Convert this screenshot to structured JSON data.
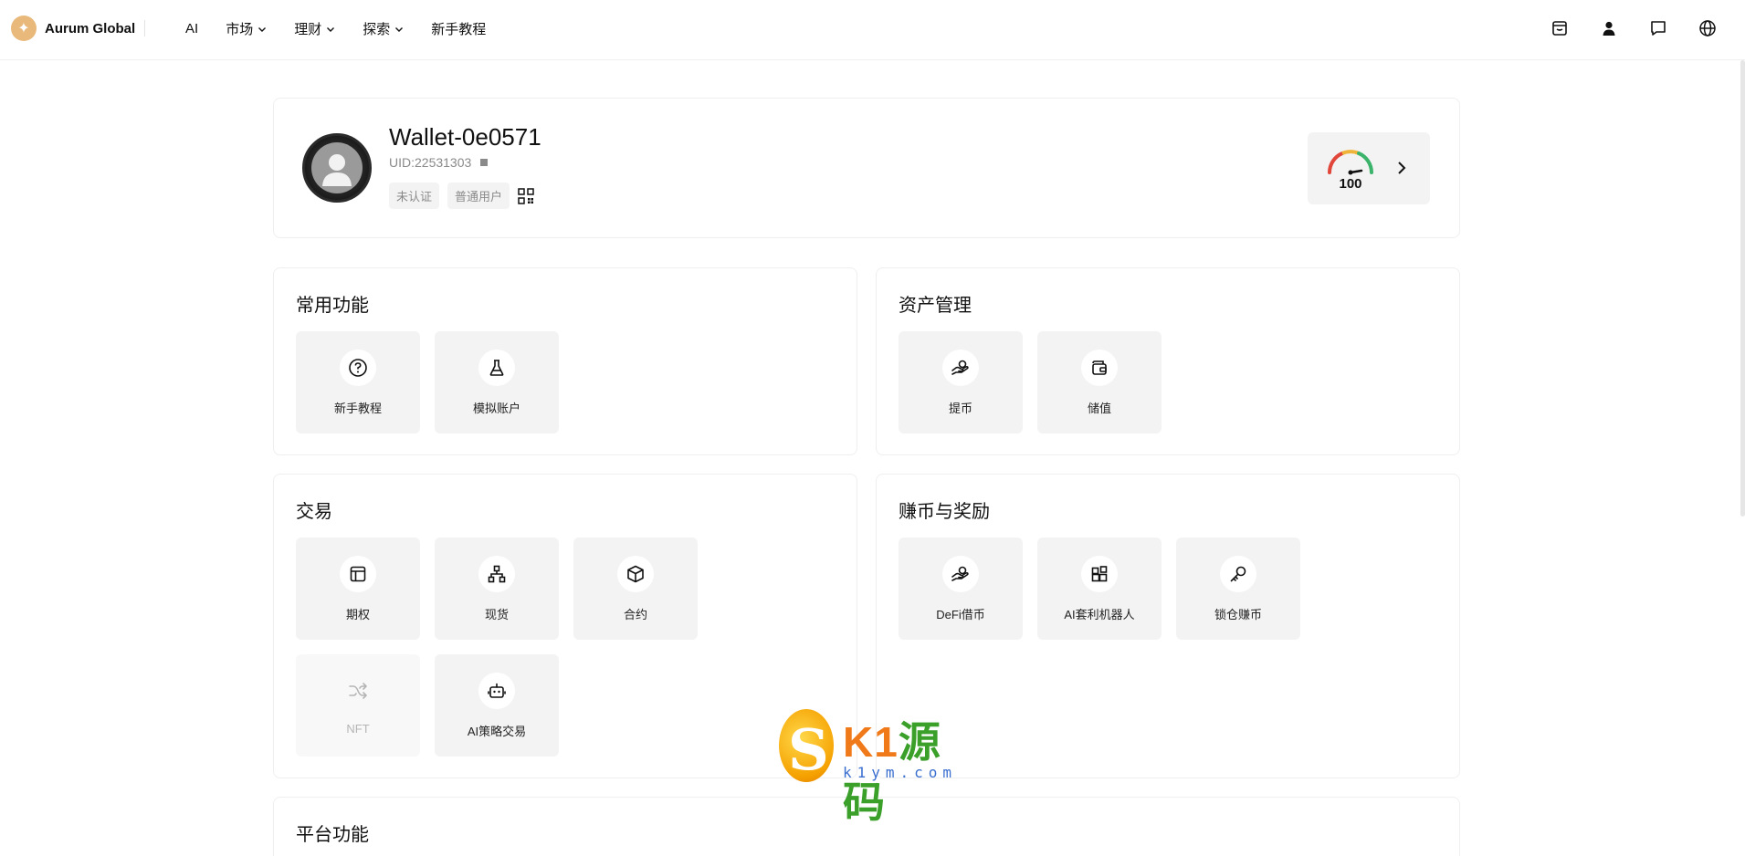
{
  "header": {
    "brand_name": "Aurum Global",
    "nav": [
      {
        "label": "AI",
        "has_dropdown": false
      },
      {
        "label": "市场",
        "has_dropdown": true
      },
      {
        "label": "理财",
        "has_dropdown": true
      },
      {
        "label": "探索",
        "has_dropdown": true
      },
      {
        "label": "新手教程",
        "has_dropdown": false
      }
    ],
    "icons": [
      "inbox-icon",
      "user-icon",
      "message-icon",
      "globe-icon"
    ]
  },
  "profile": {
    "wallet_name": "Wallet-0e0571",
    "uid": "UID:22531303",
    "tags": [
      "未认证",
      "普通用户"
    ],
    "score": "100"
  },
  "sections": {
    "common": {
      "title": "常用功能",
      "items": [
        {
          "label": "新手教程",
          "icon": "help-circle-icon"
        },
        {
          "label": "模拟账户",
          "icon": "flask-icon"
        }
      ]
    },
    "asset": {
      "title": "资产管理",
      "items": [
        {
          "label": "提币",
          "icon": "hand-coin-icon"
        },
        {
          "label": "储值",
          "icon": "wallet-icon"
        }
      ]
    },
    "trade": {
      "title": "交易",
      "items": [
        {
          "label": "期权",
          "icon": "layout-icon"
        },
        {
          "label": "现货",
          "icon": "network-icon"
        },
        {
          "label": "合约",
          "icon": "cube-icon"
        },
        {
          "label": "NFT",
          "icon": "shuffle-icon",
          "disabled": true
        },
        {
          "label": "AI策略交易",
          "icon": "robot-icon"
        }
      ]
    },
    "earn": {
      "title": "赚币与奖励",
      "items": [
        {
          "label": "DeFi借币",
          "icon": "hand-coin-icon"
        },
        {
          "label": "AI套利机器人",
          "icon": "apps-icon"
        },
        {
          "label": "锁仓赚币",
          "icon": "key-icon"
        }
      ]
    },
    "platform": {
      "title": "平台功能"
    }
  },
  "watermark": {
    "main_a": "K1",
    "main_b": "源码",
    "sub": "k1ym.com"
  },
  "colors": {
    "tile_bg": "#f3f3f3",
    "brand_gold": "#e8b97a",
    "gauge_red": "#e0463a",
    "gauge_green": "#3bb36b"
  }
}
